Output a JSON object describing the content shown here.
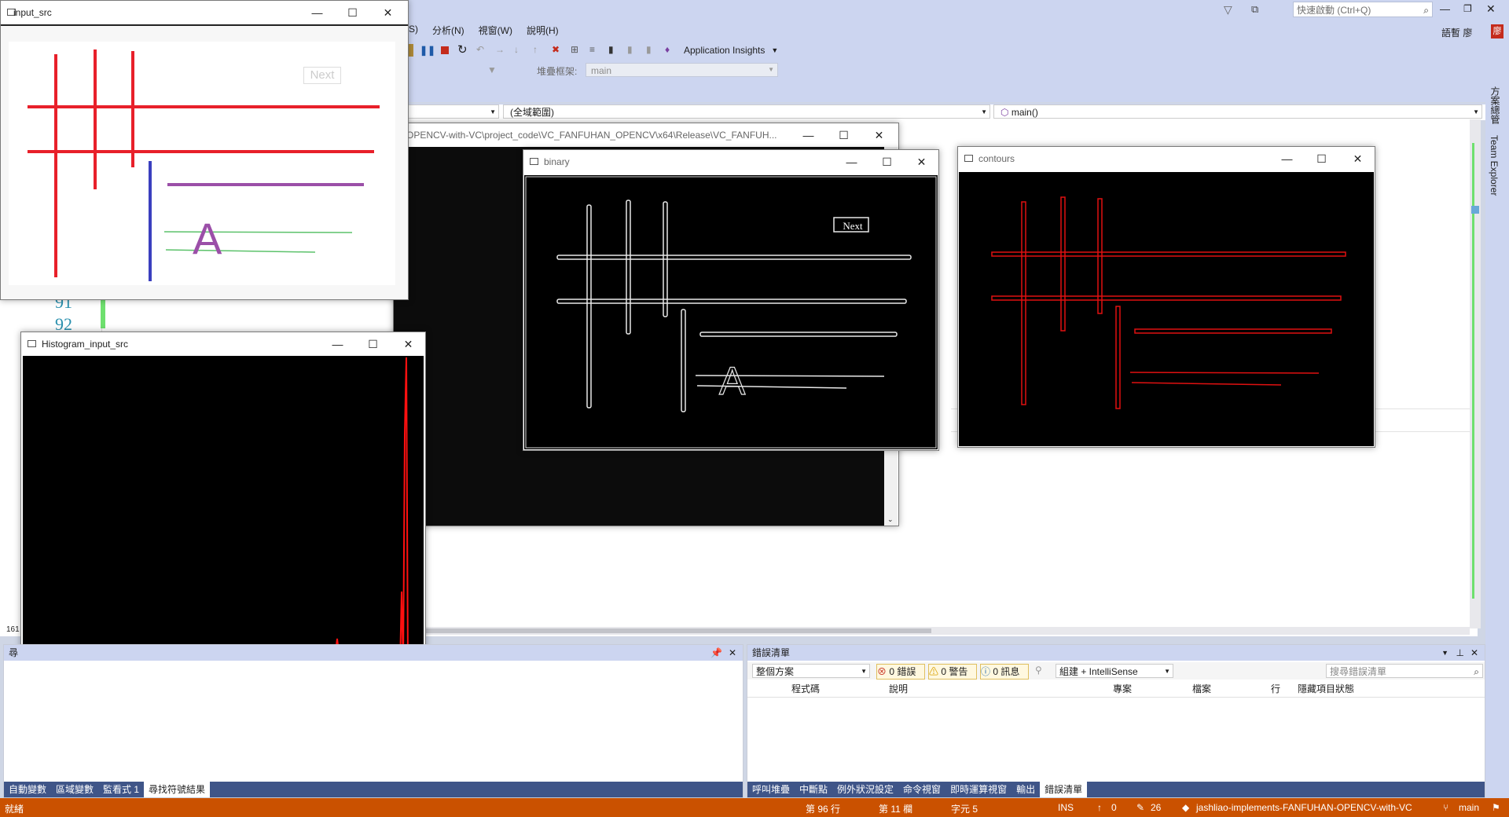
{
  "vs": {
    "menu": [
      "S)",
      "分析(N)",
      "視窗(W)",
      "說明(H)"
    ],
    "quick_launch": "快速啟動 (Ctrl+Q)",
    "user": "語暫 廖",
    "user_badge": "廖",
    "toolbar": {
      "app_insights": "Application Insights",
      "stack_label": "堆疊框架:",
      "stack_value": "main"
    },
    "nav": {
      "scope": "(全域範圍)",
      "func": "main()"
    },
    "right_rail": [
      "方案總管",
      "Team Explorer"
    ],
    "gutter": [
      "91",
      "92"
    ],
    "gutter_small": "161"
  },
  "console_window": {
    "title": "OPENCV-with-VC\\project_code\\VC_FANFUHAN_OPENCV\\x64\\Release\\VC_FANFUH..."
  },
  "cv_windows": {
    "input_src": {
      "title": "input_src",
      "button": "Next"
    },
    "histogram": {
      "title": "Histogram_input_src"
    },
    "binary": {
      "title": "binary",
      "button": "Next"
    },
    "contours": {
      "title": "contours"
    }
  },
  "left_panel": {
    "title": "尋",
    "tabs": [
      "自動變數",
      "區域變數",
      "監看式 1",
      "尋找符號結果"
    ],
    "active_tab": 3
  },
  "error_list": {
    "title": "錯誤清單",
    "scope": "整個方案",
    "errors": "0 錯誤",
    "warnings": "0 警告",
    "messages": "0 訊息",
    "build_filter": "組建 + IntelliSense",
    "search_placeholder": "搜尋錯誤清單",
    "columns": [
      "程式碼",
      "說明",
      "專案",
      "檔案",
      "行",
      "隱藏項目狀態"
    ],
    "tabs": [
      "呼叫堆疊",
      "中斷點",
      "例外狀況設定",
      "命令視窗",
      "即時運算視窗",
      "輸出",
      "錯誤清單"
    ],
    "active_tab": 6
  },
  "status": {
    "ready": "就緒",
    "line": "第 96 行",
    "col": "第 11 欄",
    "char": "字元 5",
    "ins": "INS",
    "up": "0",
    "pencil": "26",
    "repo": "jashliao-implements-FANFUHAN-OPENCV-with-VC",
    "branch": "main"
  },
  "colors": {
    "status_bar": "#ca5100",
    "vs_chrome": "#ccd5f0",
    "tab_bar": "#3f5588",
    "line_red": "#e8202a",
    "line_purple": "#9b4fa8",
    "line_blue": "#3a3fbf",
    "line_green": "#5cc26b"
  }
}
